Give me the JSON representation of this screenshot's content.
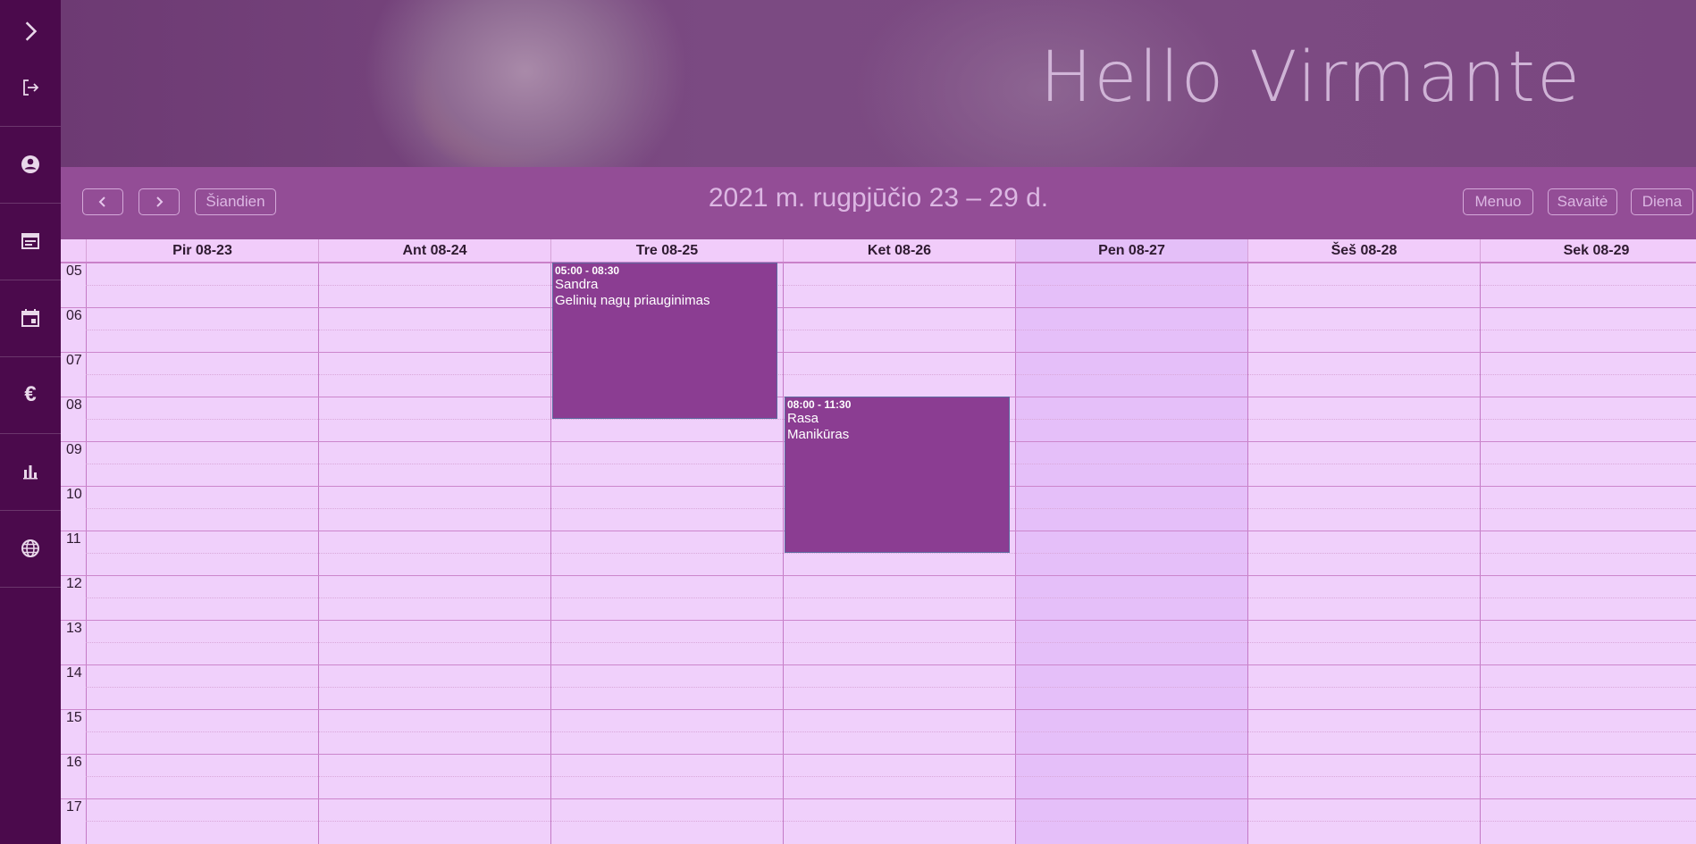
{
  "sidebar": {
    "items": [
      {
        "name": "chevron-right-icon"
      },
      {
        "name": "logout-icon"
      },
      {
        "name": "account-circle-icon"
      },
      {
        "name": "note-icon"
      },
      {
        "name": "calendar-icon"
      },
      {
        "name": "euro-icon",
        "glyph": "€"
      },
      {
        "name": "bar-chart-icon"
      },
      {
        "name": "globe-icon"
      }
    ]
  },
  "banner": {
    "greeting": "Hello Virmante"
  },
  "toolbar": {
    "prev_icon": "chevron-left-icon",
    "next_icon": "chevron-right-icon",
    "today_label": "Šiandien",
    "range_title": "2021 m. rugpjūčio 23 – 29 d.",
    "month_label": "Menuo",
    "week_label": "Savaitė",
    "day_label": "Diena"
  },
  "calendar": {
    "days": [
      {
        "label": "Pir 08-23"
      },
      {
        "label": "Ant 08-24"
      },
      {
        "label": "Tre 08-25"
      },
      {
        "label": "Ket 08-26"
      },
      {
        "label": "Pen 08-27",
        "today": true
      },
      {
        "label": "Šeš 08-28"
      },
      {
        "label": "Sek 08-29"
      }
    ],
    "hours": [
      "05",
      "06",
      "07",
      "08",
      "09",
      "10",
      "11",
      "12",
      "13",
      "14",
      "15",
      "16",
      "17"
    ],
    "events": [
      {
        "day": 2,
        "start": 5,
        "end": 8.5,
        "time": "05:00 - 08:30",
        "client": "Sandra",
        "service": "Gelinių nagų priauginimas"
      },
      {
        "day": 3,
        "start": 8,
        "end": 11.5,
        "time": "08:00 - 11:30",
        "client": "Rasa",
        "service": "Manikūras"
      }
    ]
  },
  "colors": {
    "sidebar": "#4b0a4c",
    "toolbar": "#934d96",
    "event": "#8b3d92",
    "grid_bg": "#f0d0fb",
    "today_bg": "#e5bff9"
  }
}
